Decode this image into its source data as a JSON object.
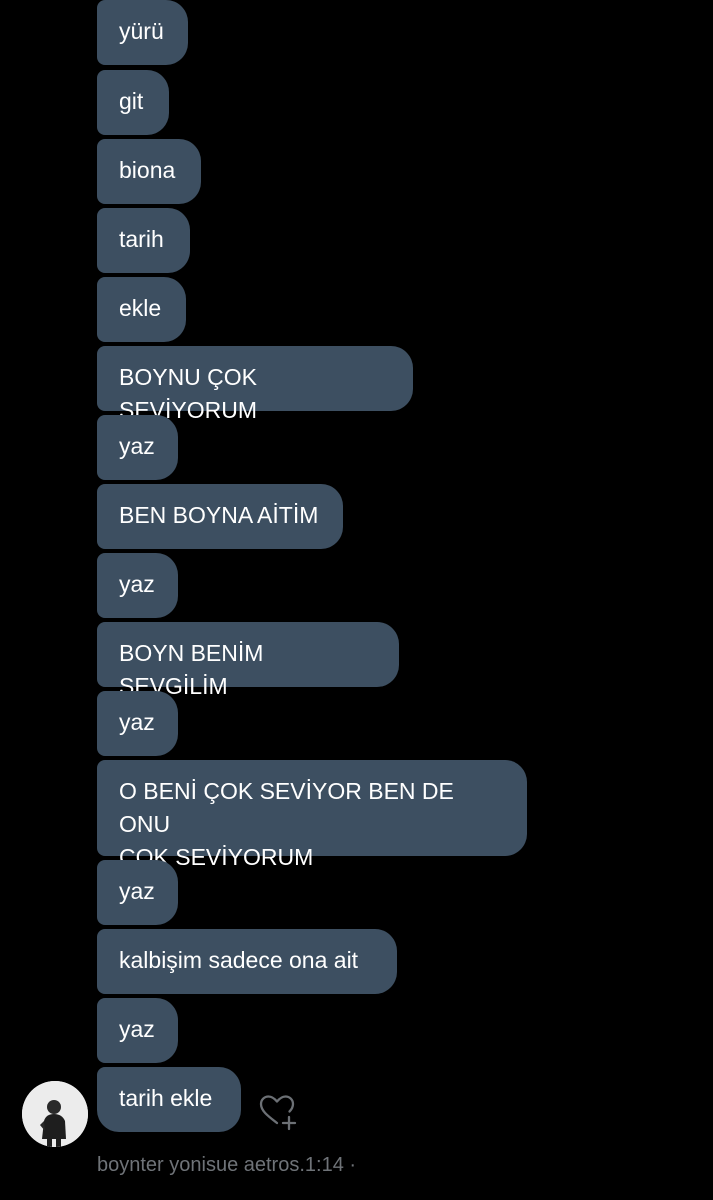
{
  "messages": [
    {
      "text": "yürü"
    },
    {
      "text": "git"
    },
    {
      "text": "biona"
    },
    {
      "text": "tarih"
    },
    {
      "text": "ekle"
    },
    {
      "text": "BOYNU ÇOK SEVİYORUM"
    },
    {
      "text": "yaz"
    },
    {
      "text": "BEN BOYNA AİTİM"
    },
    {
      "text": "yaz"
    },
    {
      "text": "BOYN BENİM SEVGİLİM"
    },
    {
      "text": "yaz"
    },
    {
      "text": "O BENİ ÇOK SEVİYOR BEN DE ONU\nÇOK SEVİYORUM"
    },
    {
      "text": "yaz"
    },
    {
      "text": "kalbişim sadece ona ait"
    },
    {
      "text": "yaz"
    },
    {
      "text": "tarih ekle"
    }
  ],
  "footer": {
    "meta": "boynter yonisue aetros.1:14 ·"
  },
  "icons": {
    "react": "heart-plus-icon",
    "avatar": "user-avatar"
  },
  "colors": {
    "background": "#000000",
    "bubble": "#3d4f61",
    "text": "#ffffff",
    "meta": "#6f7378"
  }
}
